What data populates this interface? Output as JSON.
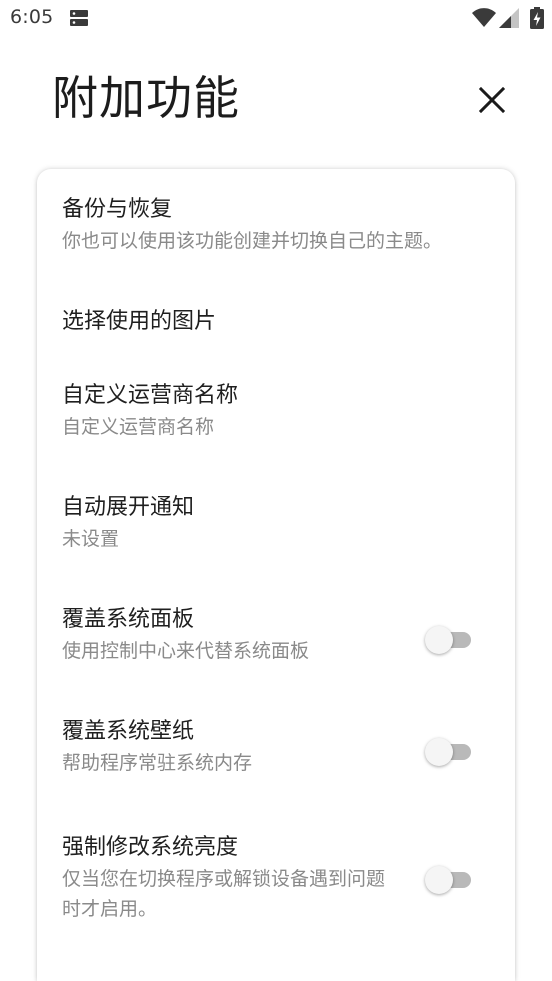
{
  "status_bar": {
    "time": "6:05",
    "icons": [
      "storage-icon",
      "wifi-icon",
      "signal-icon",
      "battery-icon"
    ]
  },
  "header": {
    "title": "附加功能",
    "close_icon": "close-icon"
  },
  "settings": [
    {
      "title": "备份与恢复",
      "subtitle": "你也可以使用该功能创建并切换自己的主题。"
    },
    {
      "title": "选择使用的图片",
      "subtitle": ""
    },
    {
      "title": "自定义运营商名称",
      "subtitle": "自定义运营商名称"
    },
    {
      "title": "自动展开通知",
      "subtitle": "未设置"
    },
    {
      "title": "覆盖系统面板",
      "subtitle": "使用控制中心来代替系统面板",
      "toggle": false
    },
    {
      "title": "覆盖系统壁纸",
      "subtitle": "帮助程序常驻系统内存",
      "toggle": false
    },
    {
      "title": "强制修改系统亮度",
      "subtitle": "仅当您在切换程序或解锁设备遇到问题时才启用。",
      "toggle": false
    }
  ],
  "colors": {
    "background": "#ffffff",
    "title_text": "#1f1f1f",
    "subtitle_text": "#8a8a8a",
    "switch_track_off": "#b9b9b9",
    "switch_thumb_off": "#f5f5f5"
  }
}
